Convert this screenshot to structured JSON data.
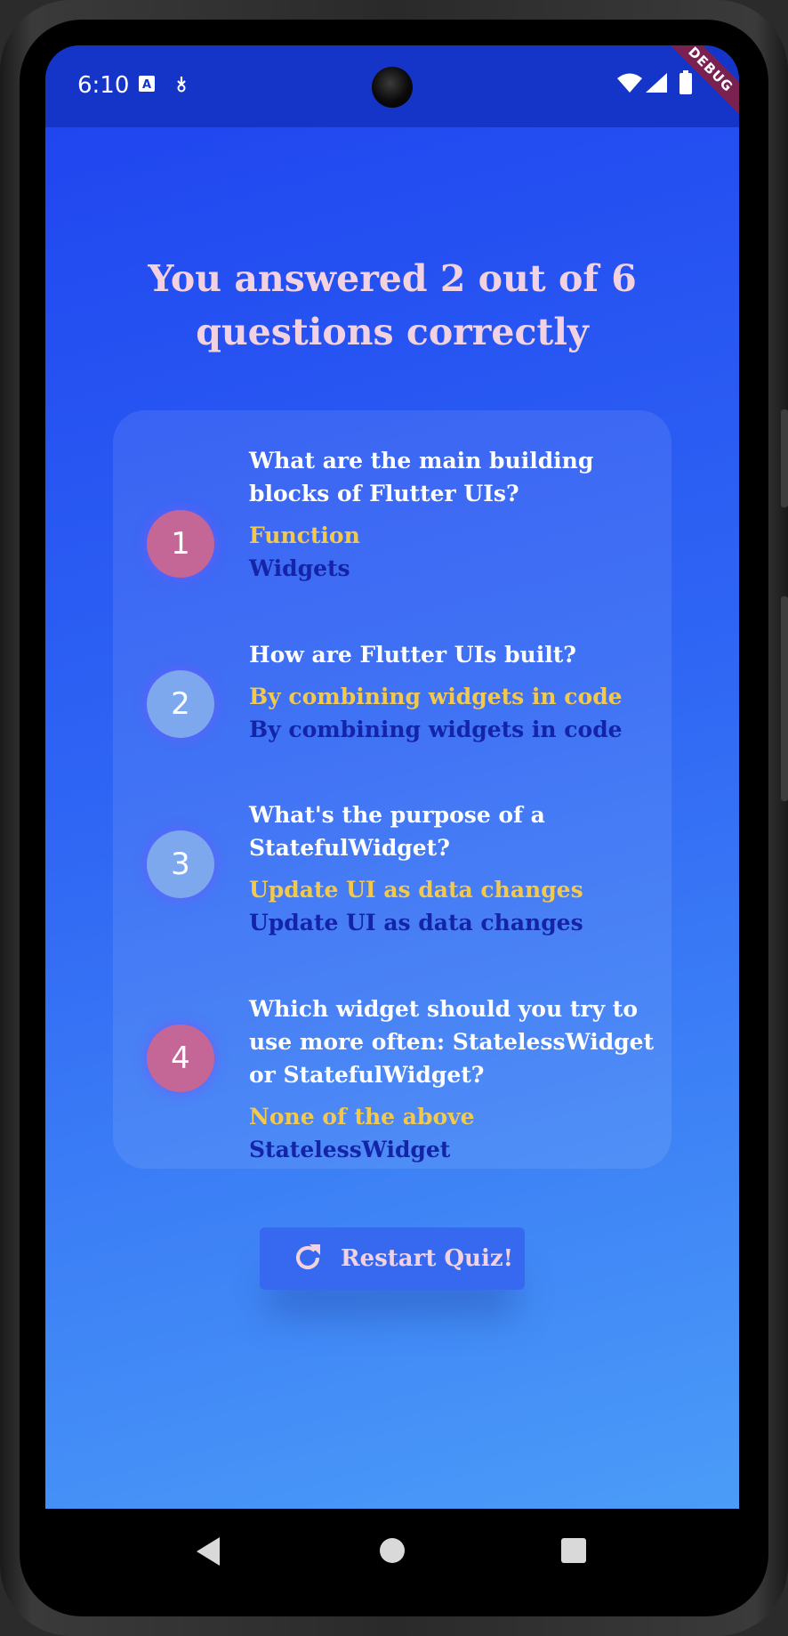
{
  "status_bar": {
    "time": "6:10",
    "icons": [
      "keyboard-a-icon",
      "download-icon",
      "wifi-icon",
      "signal-icon",
      "battery-icon"
    ],
    "debug_banner": "DEBUG"
  },
  "summary": {
    "title": "You answered 2 out of 6 questions correctly"
  },
  "results": [
    {
      "number": "1",
      "correct": false,
      "question": "What are the main building blocks of Flutter UIs?",
      "user_answer": "Function",
      "correct_answer": "Widgets"
    },
    {
      "number": "2",
      "correct": true,
      "question": "How are Flutter UIs built?",
      "user_answer": "By combining widgets in code",
      "correct_answer": "By combining widgets in code"
    },
    {
      "number": "3",
      "correct": true,
      "question": "What's the purpose of a StatefulWidget?",
      "user_answer": "Update UI as data changes",
      "correct_answer": "Update UI as data changes"
    },
    {
      "number": "4",
      "correct": false,
      "question": "Which widget should you try to use more often: StatelessWidget or StatefulWidget?",
      "user_answer": "None of the above",
      "correct_answer": "StatelessWidget"
    }
  ],
  "restart_button": {
    "label": "Restart Quiz!",
    "icon": "refresh-icon"
  },
  "colors": {
    "background_top": "#2046f0",
    "background_bottom": "#4b9cf8",
    "title": "#f2d2e0",
    "user_answer": "#f2c94c",
    "correct_answer": "#1424a8",
    "badge_wrong": "#c46796",
    "badge_right": "#7ea8ee"
  },
  "nav_bar": {
    "icons": [
      "back-icon",
      "home-icon",
      "recents-icon"
    ]
  }
}
